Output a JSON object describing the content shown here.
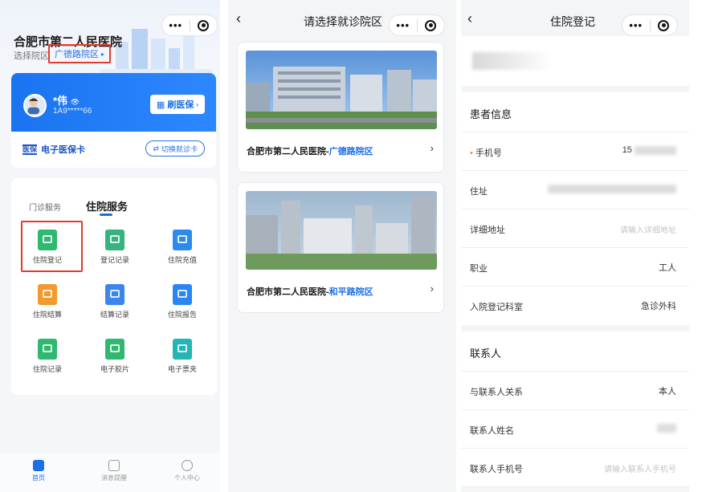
{
  "panel1": {
    "hospital_title": "合肥市第二人民医院",
    "select_label": "选择院区",
    "campus": "广德路院区",
    "user_name": "*伟",
    "user_id": "1A9*****66",
    "swipe_label": "刷医保",
    "ecard_brand": "医保",
    "ecard_label": "电子医保卡",
    "switch_label": "切换就诊卡",
    "tabs": [
      "门诊服务",
      "住院服务"
    ],
    "services": [
      {
        "label": "住院登记",
        "icon": "register-icon",
        "color": "#2fb870"
      },
      {
        "label": "登记记录",
        "icon": "record-icon",
        "color": "#36b37e"
      },
      {
        "label": "住院充值",
        "icon": "wallet-icon",
        "color": "#2a8af0"
      },
      {
        "label": "住院结算",
        "icon": "settle-icon",
        "color": "#f39a2b"
      },
      {
        "label": "结算记录",
        "icon": "bill-icon",
        "color": "#3a86f0"
      },
      {
        "label": "住院报告",
        "icon": "report-icon",
        "color": "#2a86f0"
      },
      {
        "label": "住院记录",
        "icon": "bed-icon",
        "color": "#2fb870"
      },
      {
        "label": "电子胶片",
        "icon": "film-icon",
        "color": "#2fb870"
      },
      {
        "label": "电子票夹",
        "icon": "ticket-icon",
        "color": "#26b5b5"
      }
    ],
    "tabbar": [
      "首页",
      "消息提醒",
      "个人中心"
    ]
  },
  "panel2": {
    "title": "请选择就诊院区",
    "hospitals": [
      {
        "prefix": "合肥市第二人民医院-",
        "campus": "广德路院区"
      },
      {
        "prefix": "合肥市第二人民医院-",
        "campus": "和平路院区"
      }
    ]
  },
  "panel3": {
    "title": "住院登记",
    "patient_section": "患者信息",
    "phone_label": "手机号",
    "phone_value": "15",
    "address_label": "住址",
    "detail_label": "详细地址",
    "detail_placeholder": "请输入详细地址",
    "job_label": "职业",
    "job_value": "工人",
    "dept_label": "入院登记科室",
    "dept_value": "急诊外科",
    "contact_section": "联系人",
    "relation_label": "与联系人关系",
    "relation_value": "本人",
    "contact_name_label": "联系人姓名",
    "contact_phone_label": "联系人手机号",
    "contact_phone_placeholder": "请输入联系人手机号"
  },
  "colors": {
    "accent": "#1a6fe8",
    "highlight": "#e23b2f",
    "required": "#f08a24"
  }
}
